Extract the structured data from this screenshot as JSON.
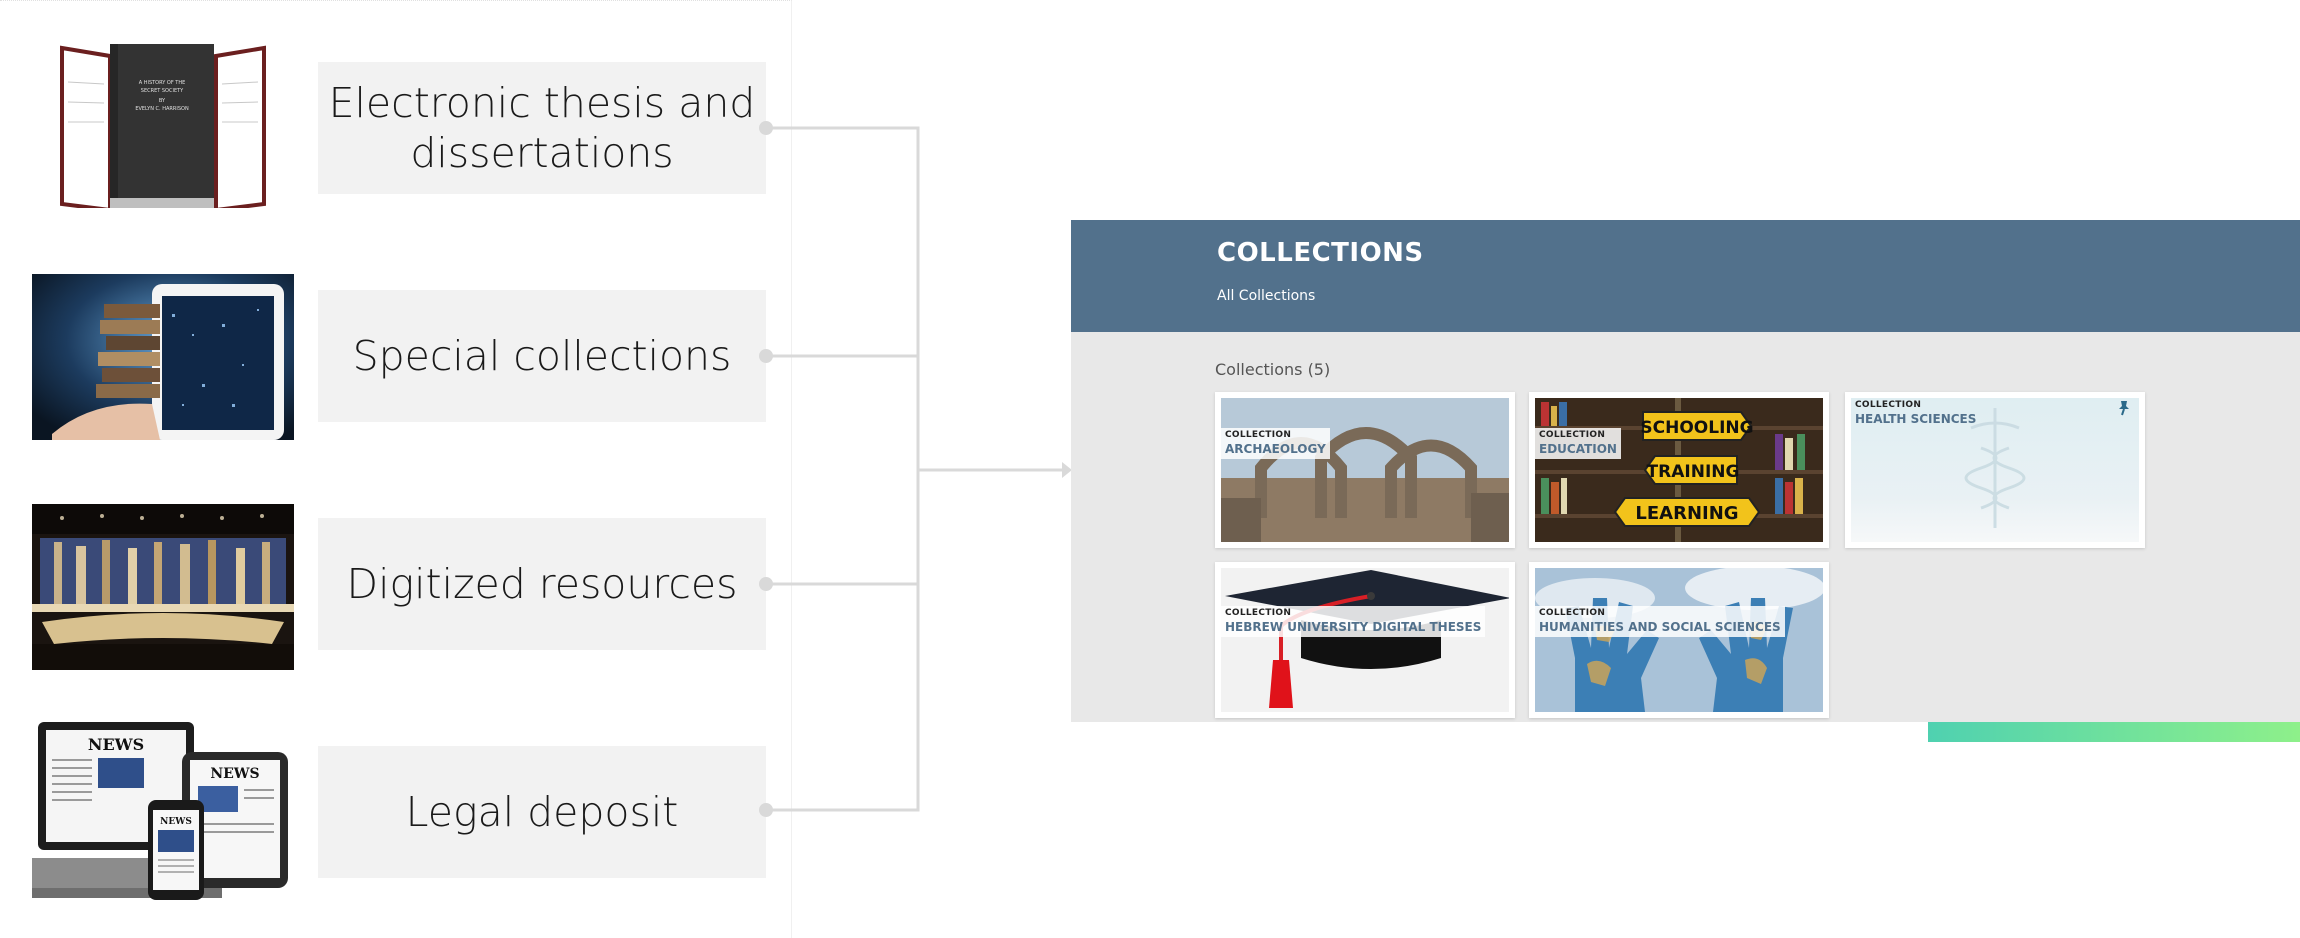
{
  "sources": [
    {
      "id": "etd",
      "label": "Electronic thesis and dissertations",
      "label_lines": [
        "Electronic thesis and",
        "dissertations"
      ],
      "image": "bound-thesis-book"
    },
    {
      "id": "special",
      "label": "Special collections",
      "label_lines": [
        "Special collections"
      ],
      "image": "tablet-books-digital"
    },
    {
      "id": "digitized",
      "label": "Digitized resources",
      "label_lines": [
        "Digitized resources"
      ],
      "image": "museum-exhibit"
    },
    {
      "id": "legal",
      "label": "Legal deposit",
      "label_lines": [
        "Legal deposit"
      ],
      "image": "news-devices"
    }
  ],
  "book_cover_text": [
    "A HISTORY OF THE",
    "SECRET SOCIETY",
    "BY",
    "EVELYN C. HARRISON"
  ],
  "news_text": [
    "NEWS",
    "NEWS",
    "NEWS"
  ],
  "collections_page": {
    "title": "COLLECTIONS",
    "breadcrumb": "All Collections",
    "count_label": "Collections (5)",
    "cards": [
      {
        "kind": "COLLECTION",
        "name": "ARCHAEOLOGY",
        "image": "stone-arches"
      },
      {
        "kind": "COLLECTION",
        "name": "EDUCATION",
        "image": "bookshelf-signs"
      },
      {
        "kind": "COLLECTION",
        "name": "HEALTH SCIENCES",
        "image": "caduceus",
        "pinned": true
      },
      {
        "kind": "COLLECTION",
        "name": "HEBREW UNIVERSITY DIGITAL THESES",
        "image": "graduation-cap"
      },
      {
        "kind": "COLLECTION",
        "name": "HUMANITIES AND SOCIAL SCIENCES",
        "image": "hands-world-map"
      }
    ],
    "education_signs": [
      "SCHOOLING",
      "TRAINING",
      "LEARNING"
    ]
  },
  "colors": {
    "header": "#52718c",
    "label_bg": "#f2f2f2",
    "connector": "#d9d9d9",
    "accent_green": "#8ef08a"
  }
}
